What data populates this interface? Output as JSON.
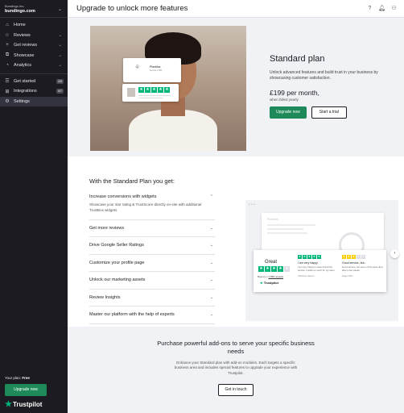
{
  "sidebar": {
    "company_name": "Bundingo Inc.",
    "domain": "bundingo.com",
    "items": [
      {
        "label": "Home",
        "icon": "home-icon"
      },
      {
        "label": "Reviews",
        "icon": "star-icon"
      },
      {
        "label": "Get reviews",
        "icon": "plus-icon"
      },
      {
        "label": "Showcase",
        "icon": "showcase-icon"
      },
      {
        "label": "Analytics",
        "icon": "analytics-icon"
      }
    ],
    "items2": [
      {
        "label": "Get started",
        "badge": "2/5"
      },
      {
        "label": "Integrations",
        "badge": "0/7"
      },
      {
        "label": "Settings"
      }
    ],
    "plan_label": "Your plan:",
    "plan_value": "Free",
    "upgrade_label": "Upgrade now",
    "logo_text": "Trustpilot"
  },
  "header": {
    "title": "Upgrade to unlock more features"
  },
  "hero": {
    "card_name": "Plantitus",
    "card_sub": "Service 1,883",
    "plan_title": "Standard plan",
    "plan_desc": "Unlock advanced features and build trust in your business by showcasing customer satisfaction.",
    "price": "£199 per month,",
    "billed": "when billed yearly",
    "primary_btn": "Upgrade now",
    "secondary_btn": "Start a trial"
  },
  "features": {
    "title": "With the Standard Plan you get:",
    "items": [
      {
        "label": "Increase conversions with widgets",
        "desc": "Showcase your star rating & TrustScore directly on-site with additional TrustBox widgets"
      },
      {
        "label": "Get more reviews"
      },
      {
        "label": "Drive Google Seller Ratings"
      },
      {
        "label": "Customize your profile page"
      },
      {
        "label": "Unlock our marketing assets"
      },
      {
        "label": "Review Insights"
      },
      {
        "label": "Master our platform with the help of experts"
      }
    ]
  },
  "illustration": {
    "ghost_title": "Plantitus",
    "great": "Great",
    "based_on": "Based on",
    "reviews_link": "1,883 reviews",
    "tp": "Trustpilot",
    "reviews": [
      {
        "title": "I am very happy",
        "body": "I am very happy to have found this service, it adds so much for my team.",
        "author": "Christine Garner"
      },
      {
        "title": "Good service, but...",
        "body": "Good service, but some of the parts died after a few weeks.",
        "author": "Hugo Ortiz"
      }
    ]
  },
  "addons": {
    "title": "Purchase powerful add-ons to serve your specific business needs",
    "desc": "Enhance your Standard plan with add-on modules. Each targets a specific business area and includes special features to upgrade your experience with Trustpilot.",
    "btn": "Get in touch"
  },
  "colors": {
    "accent": "#1e8a5a",
    "star_green": "#00b67a",
    "sidebar": "#1b1b21"
  }
}
